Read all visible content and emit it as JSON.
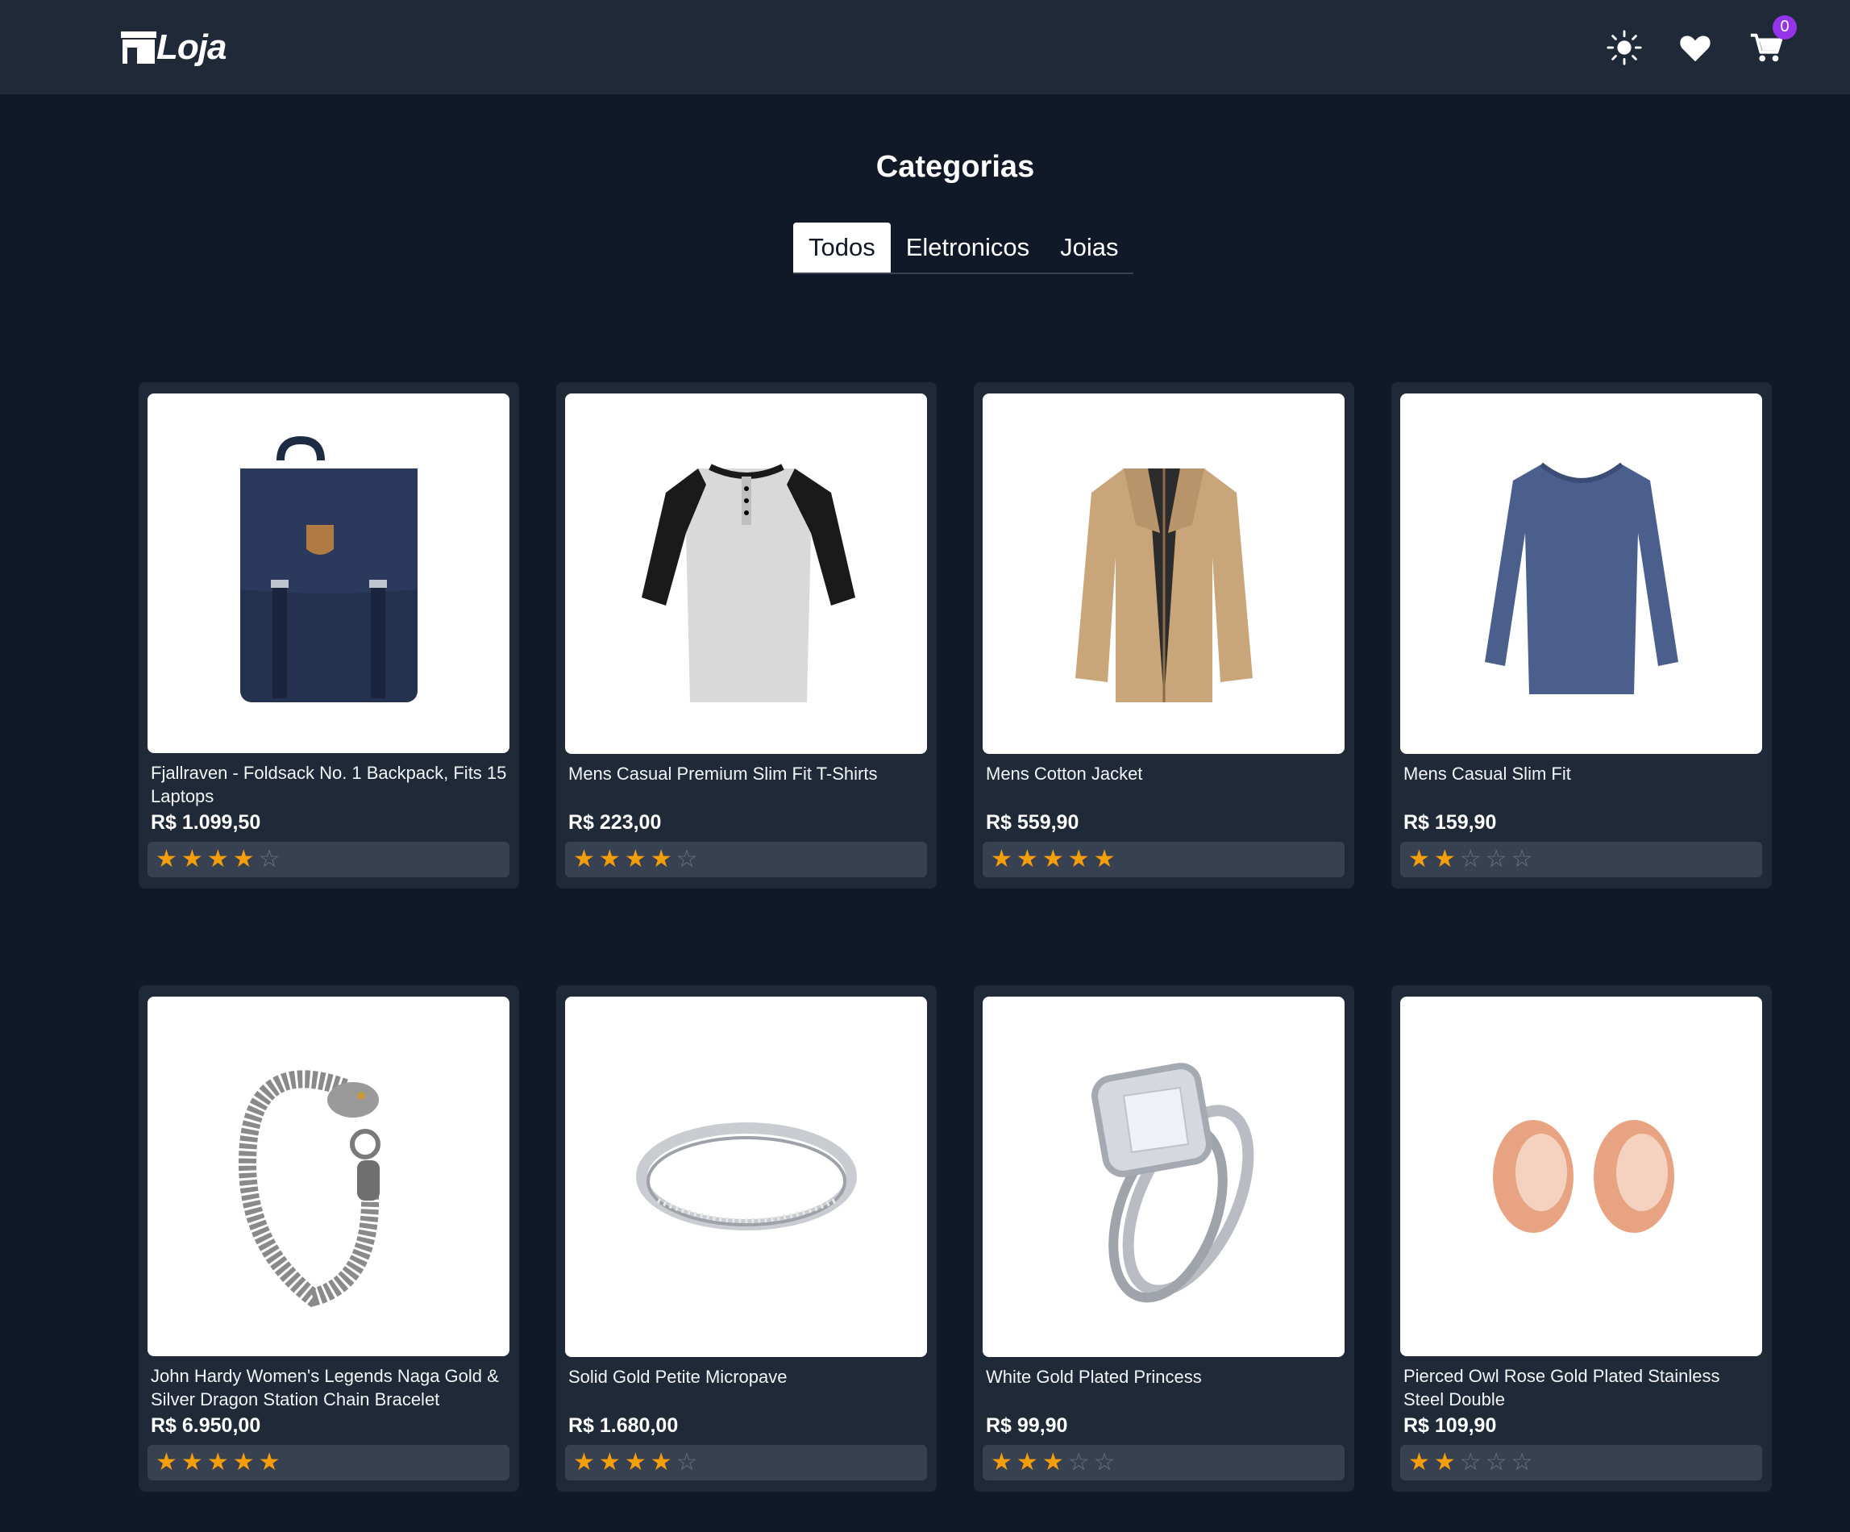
{
  "header": {
    "logo_text": "Loja",
    "cart_count": "0"
  },
  "categories": {
    "title": "Categorias",
    "tabs": [
      {
        "label": "Todos",
        "active": true
      },
      {
        "label": "Eletronicos",
        "active": false
      },
      {
        "label": "Joias",
        "active": false
      }
    ]
  },
  "products": [
    {
      "name": "Fjallraven - Foldsack No. 1 Backpack, Fits 15 Laptops",
      "price": "R$ 1.099,50",
      "rating": 4,
      "image": "backpack"
    },
    {
      "name": "Mens Casual Premium Slim Fit T-Shirts",
      "price": "R$ 223,00",
      "rating": 4,
      "image": "raglan-shirt"
    },
    {
      "name": "Mens Cotton Jacket",
      "price": "R$ 559,90",
      "rating": 5,
      "image": "jacket"
    },
    {
      "name": "Mens Casual Slim Fit",
      "price": "R$ 159,90",
      "rating": 2,
      "image": "long-sleeve-shirt"
    },
    {
      "name": "John Hardy Women's Legends Naga Gold & Silver Dragon Station Chain Bracelet",
      "price": "R$ 6.950,00",
      "rating": 5,
      "image": "bracelet"
    },
    {
      "name": "Solid Gold Petite Micropave",
      "price": "R$ 1.680,00",
      "rating": 4,
      "image": "ring"
    },
    {
      "name": "White Gold Plated Princess",
      "price": "R$ 99,90",
      "rating": 3,
      "image": "diamond-ring"
    },
    {
      "name": "Pierced Owl Rose Gold Plated Stainless Steel Double",
      "price": "R$ 109,90",
      "rating": 2,
      "image": "ear-plugs"
    }
  ],
  "colors": {
    "background": "#111827",
    "header": "#1f2937",
    "card": "#1f2937",
    "star": "#f59e0b",
    "badge": "#9333ea"
  }
}
